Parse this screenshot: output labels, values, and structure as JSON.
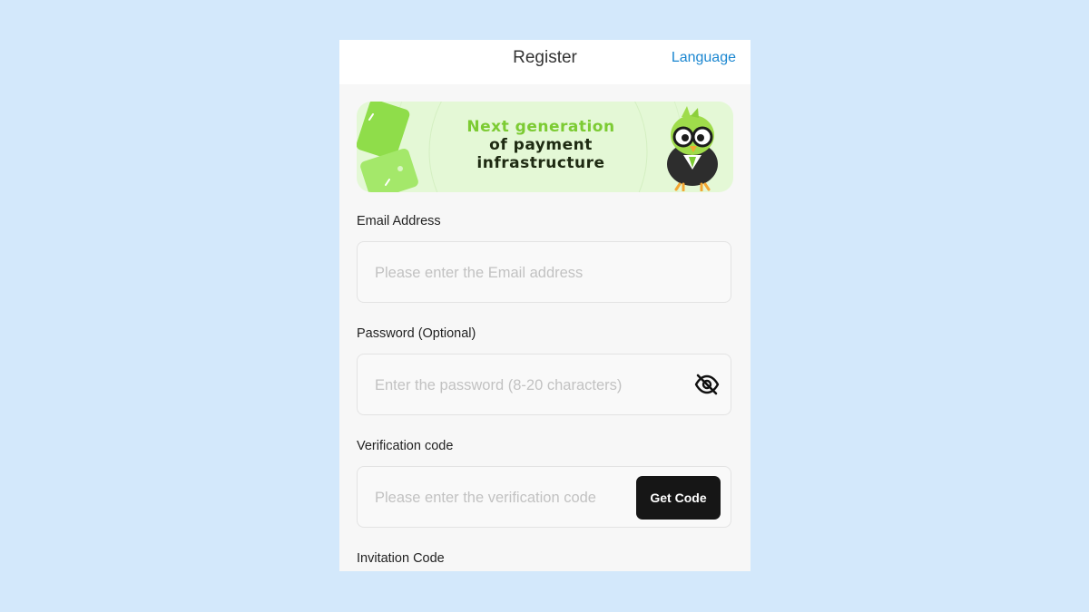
{
  "header": {
    "title": "Register",
    "language_label": "Language"
  },
  "banner": {
    "line1": "Next generation",
    "line2": "of payment",
    "line3": "infrastructure",
    "mascot_icon": "owl-mascot-icon"
  },
  "form": {
    "email": {
      "label": "Email Address",
      "placeholder": "Please enter the Email address",
      "value": ""
    },
    "password": {
      "label": "Password (Optional)",
      "placeholder": "Enter the password (8-20 characters)",
      "value": "",
      "toggle_icon": "eye-off-icon"
    },
    "verification": {
      "label": "Verification code",
      "placeholder": "Please enter the verification code",
      "value": "",
      "button_label": "Get Code"
    },
    "invitation": {
      "label": "Invitation Code"
    }
  },
  "colors": {
    "accent": "#1a86d0",
    "button_bg": "#161616",
    "page_bg": "#d3e8fb",
    "banner_green": "#7ccb33"
  }
}
